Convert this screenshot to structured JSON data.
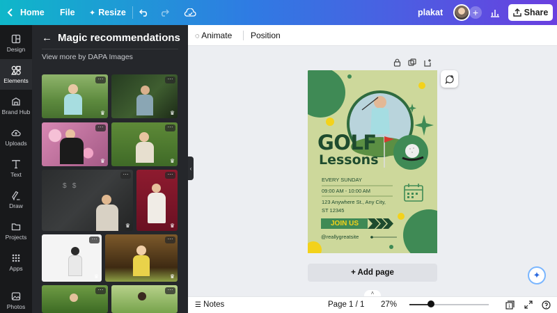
{
  "topbar": {
    "home_label": "Home",
    "file_label": "File",
    "resize_label": "Resize",
    "doc_title": "plakat",
    "share_label": "Share"
  },
  "rail": {
    "items": [
      {
        "label": "Design",
        "icon": "layout-icon"
      },
      {
        "label": "Elements",
        "icon": "shapes-icon"
      },
      {
        "label": "Brand Hub",
        "icon": "brand-hub-icon"
      },
      {
        "label": "Uploads",
        "icon": "cloud-upload-icon"
      },
      {
        "label": "Text",
        "icon": "text-icon"
      },
      {
        "label": "Draw",
        "icon": "pen-icon"
      },
      {
        "label": "Projects",
        "icon": "folder-icon"
      },
      {
        "label": "Apps",
        "icon": "apps-grid-icon"
      },
      {
        "label": "Photos",
        "icon": "photo-icon"
      }
    ]
  },
  "panel": {
    "title": "Magic recommendations",
    "view_more": "View more by DAPA Images"
  },
  "editor_toolbar": {
    "animate_label": "Animate",
    "position_label": "Position"
  },
  "poster": {
    "headline": "GOLF",
    "subheadline": "Lessons",
    "when": "EVERY SUNDAY",
    "time": "09:00 AM - 10:00 AM",
    "address_line1": "123 Anywhere St., Any City,",
    "address_line2": "ST 12345",
    "cta": "JOIN US",
    "handle": "@reallygreatsite",
    "colors": {
      "background": "#cdd89b",
      "green": "#3f8a55",
      "dark": "#1e4b2e",
      "yellow": "#f3d21b"
    }
  },
  "canvas": {
    "add_page_label": "+ Add page"
  },
  "footer": {
    "notes_label": "Notes",
    "page_indicator": "Page 1 / 1",
    "zoom": "27%"
  }
}
